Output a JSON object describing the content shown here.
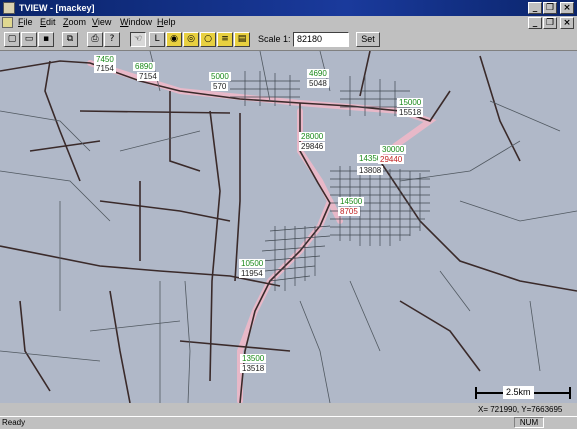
{
  "window": {
    "title": "TVIEW - [mackey]"
  },
  "menu": {
    "items": [
      "File",
      "Edit",
      "Zoom",
      "View",
      "Window",
      "Help"
    ]
  },
  "toolbar": {
    "scale_label": "Scale 1:",
    "scale_value": "82180",
    "set_label": "Set"
  },
  "map": {
    "labels": [
      {
        "text": "7450",
        "color": "green"
      },
      {
        "text": "7154",
        "color": "black"
      },
      {
        "text": "6890",
        "color": "green"
      },
      {
        "text": "7154",
        "color": "black"
      },
      {
        "text": "5000",
        "color": "green"
      },
      {
        "text": "570",
        "color": "black"
      },
      {
        "text": "4690",
        "color": "green"
      },
      {
        "text": "5048",
        "color": "black"
      },
      {
        "text": "15000",
        "color": "green"
      },
      {
        "text": "15518",
        "color": "black"
      },
      {
        "text": "28000",
        "color": "green"
      },
      {
        "text": "29846",
        "color": "black"
      },
      {
        "text": "30000",
        "color": "green"
      },
      {
        "text": "14350",
        "color": "green"
      },
      {
        "text": "29440",
        "color": "red"
      },
      {
        "text": "13808",
        "color": "black"
      },
      {
        "text": "14500",
        "color": "green"
      },
      {
        "text": "8705",
        "color": "red"
      },
      {
        "text": "10500",
        "color": "green"
      },
      {
        "text": "11954",
        "color": "black"
      },
      {
        "text": "13500",
        "color": "green"
      },
      {
        "text": "13518",
        "color": "black"
      }
    ],
    "scalebar_label": "2.5km"
  },
  "coordinates": "X= 721990, Y=7663695",
  "status": {
    "text": "Ready",
    "num_indicator": "NUM"
  }
}
